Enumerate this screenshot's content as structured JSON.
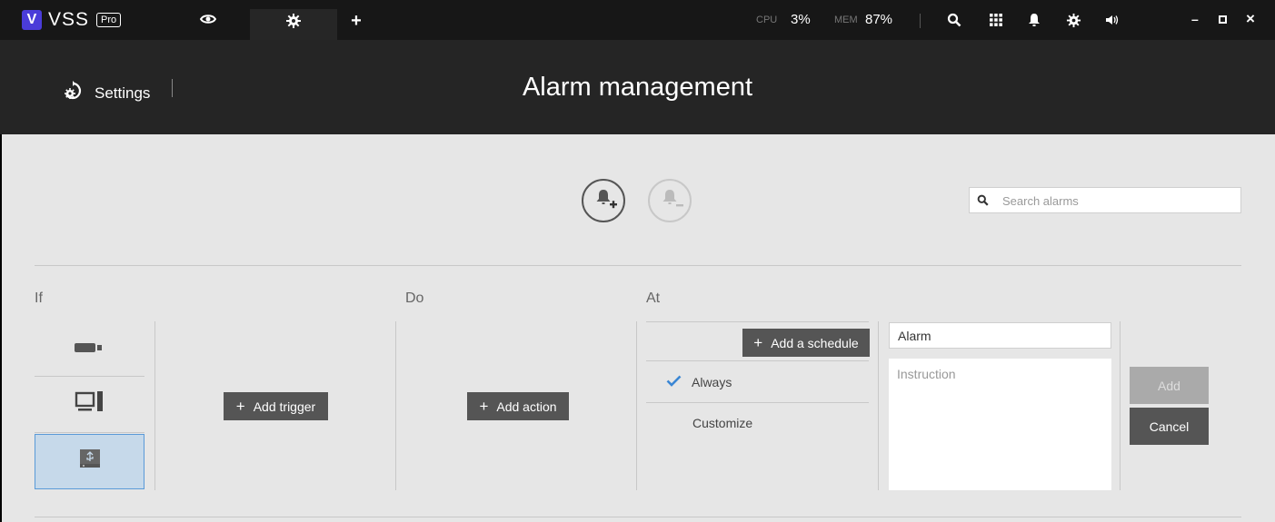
{
  "app": {
    "logo_letter": "V",
    "logo_name": "VSS",
    "edition": "Pro"
  },
  "topbar": {
    "tabs": [
      {
        "icon": "eye-icon",
        "active": false
      },
      {
        "icon": "gear-icon",
        "active": true
      },
      {
        "icon": "plus-icon",
        "label": "+",
        "active": false
      }
    ],
    "cpu_label": "CPU",
    "cpu_value": "3%",
    "mem_label": "MEM",
    "mem_value": "87%",
    "icons": [
      "search-icon",
      "grid-icon",
      "bell-icon",
      "gear-icon",
      "speaker-icon"
    ],
    "window_controls": {
      "minimize": "–",
      "maximize": "▫",
      "close": "×"
    }
  },
  "header": {
    "settings_label": "Settings",
    "page_title": "Alarm management"
  },
  "toolbar": {
    "add_alarm_icon": "bell-add-icon",
    "remove_alarm_icon": "bell-remove-icon",
    "search_placeholder": "Search alarms"
  },
  "sections": {
    "if_label": "If",
    "do_label": "Do",
    "at_label": "At"
  },
  "sources": [
    {
      "icon": "camera-icon",
      "selected": false
    },
    {
      "icon": "computer-icon",
      "selected": false
    },
    {
      "icon": "usb-drive-icon",
      "selected": true
    }
  ],
  "buttons": {
    "add_trigger": "Add trigger",
    "add_action": "Add action",
    "add_schedule": "Add a schedule",
    "plus": "+",
    "add": "Add",
    "cancel": "Cancel"
  },
  "schedule": {
    "options": [
      {
        "label": "Always",
        "checked": true
      },
      {
        "label": "Customize",
        "checked": false
      }
    ]
  },
  "alarm_form": {
    "name_value": "Alarm",
    "instruction_placeholder": "Instruction"
  },
  "colors": {
    "accent": "#4a3cd9",
    "check": "#3a86d4",
    "selected_bg": "#c6d9ea",
    "selected_border": "#5a9ad8"
  }
}
